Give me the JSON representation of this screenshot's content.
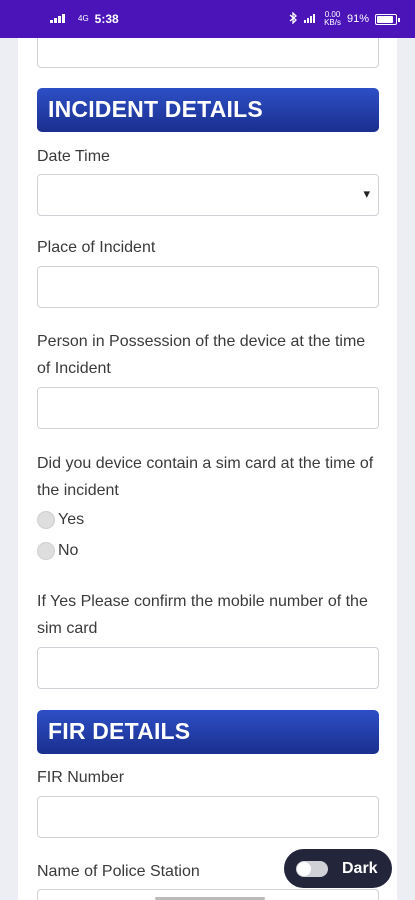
{
  "status_bar": {
    "time": "5:38",
    "signal_1": "4G",
    "network_speed_top": "0.00",
    "network_speed_bottom": "KB/s",
    "battery": "91%",
    "battery_level": 0.91
  },
  "sections": {
    "incident_title": "INCIDENT DETAILS",
    "fir_title": "FIR DETAILS"
  },
  "fields": {
    "date_time_label": "Date Time",
    "place_label": "Place of Incident",
    "person_label": "Person in Possession of the device at the time of Incident",
    "sim_question": "Did you device contain a sim card at the time of the incident",
    "sim_options": {
      "yes": "Yes",
      "no": "No"
    },
    "mobile_confirm_label": "If Yes Please confirm the mobile number of the sim card",
    "fir_number_label": "FIR Number",
    "police_station_label": "Name of Police Station"
  },
  "theme_toggle": {
    "label": "Dark",
    "on": false
  },
  "colors": {
    "status_bar": "#4a14b8",
    "header_gradient_top": "#2d4fc6",
    "header_gradient_bottom": "#1a2f8e",
    "toggle_bg": "#23263a"
  }
}
